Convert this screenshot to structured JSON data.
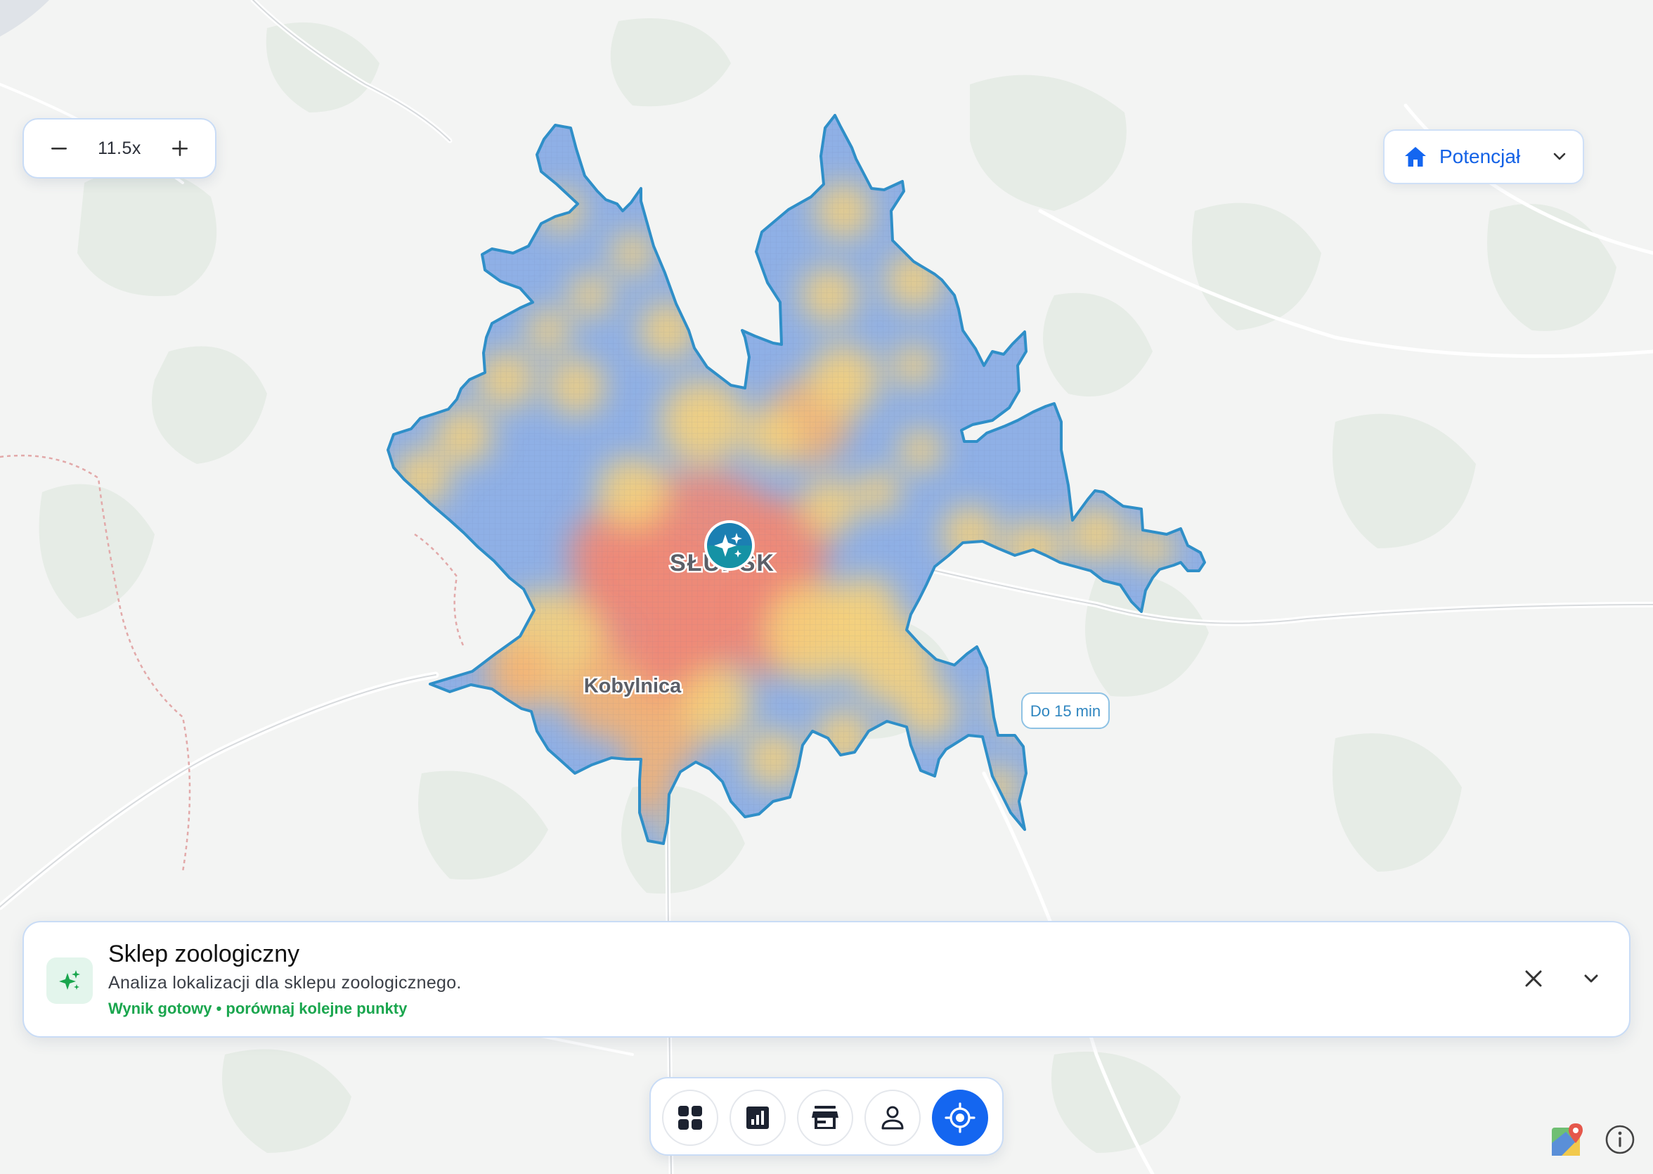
{
  "zoom": {
    "value": "11.5x"
  },
  "layer": {
    "label": "Potencjał",
    "icon": "home-icon"
  },
  "map": {
    "places": [
      "SŁUPSK",
      "Kobylnica"
    ],
    "isochrone_label": "Do 15 min",
    "marker_icon": "sparkles-icon",
    "heat_colors": {
      "low": "#8fb0e6",
      "mid": "#f7d27a",
      "high": "#ee8a78"
    },
    "outline_color": "#2f8fc8"
  },
  "card": {
    "title": "Sklep zoologiczny",
    "subtitle": "Analiza lokalizacji dla sklepu zoologicznego.",
    "status": "Wynik gotowy • porównaj kolejne punkty",
    "icon": "sparkles-icon"
  },
  "toolbar": {
    "items": [
      {
        "name": "dashboard",
        "icon": "grid-icon"
      },
      {
        "name": "statistics",
        "icon": "chart-icon"
      },
      {
        "name": "stores",
        "icon": "store-icon"
      },
      {
        "name": "profile",
        "icon": "person-icon"
      },
      {
        "name": "location",
        "icon": "target-icon",
        "active": true
      }
    ]
  },
  "colors": {
    "accent": "#1466f0",
    "success": "#1aa64e",
    "border": "#c9dcf6"
  }
}
